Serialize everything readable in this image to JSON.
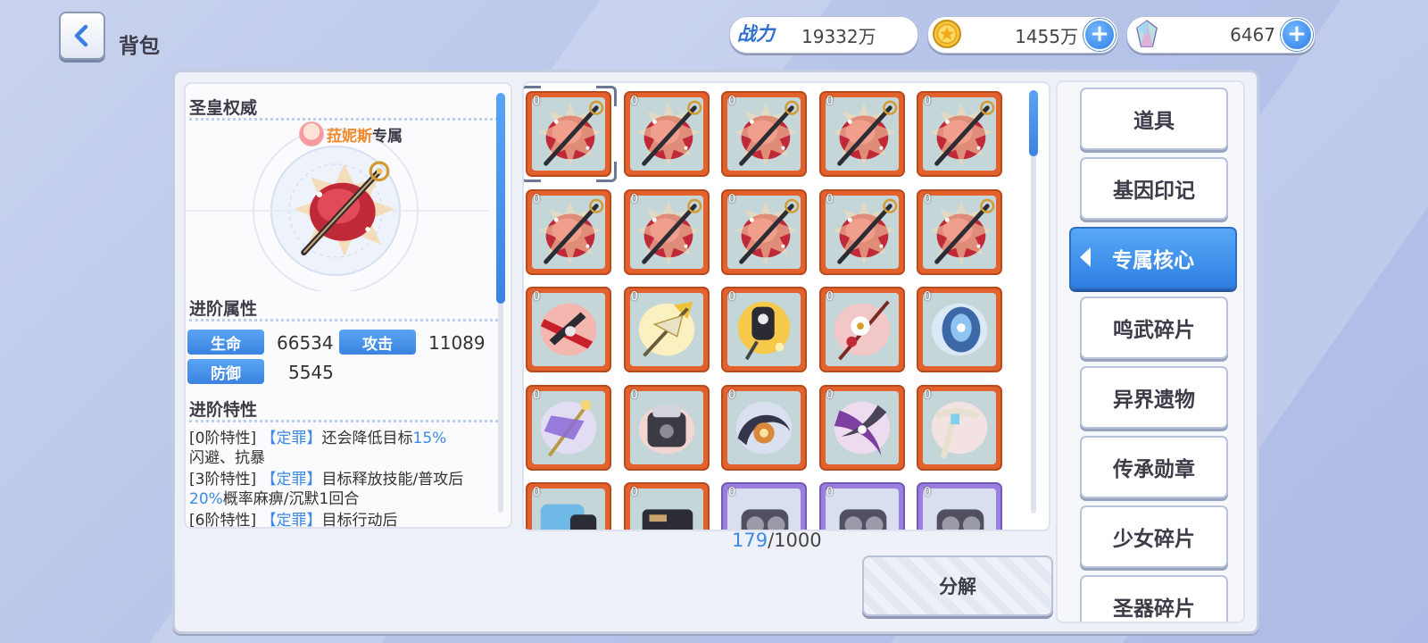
{
  "header": {
    "title": "背包",
    "back_icon": "back-arrow-icon"
  },
  "resources": {
    "power": {
      "label": "战力",
      "value": "19332万"
    },
    "gold": {
      "value": "1455万",
      "icon": "gold-coin-icon"
    },
    "gem": {
      "value": "6467",
      "icon": "crystal-icon"
    }
  },
  "detail": {
    "item_name": "圣皇权威",
    "owner": "菈妮斯",
    "exclusive_suffix": "专属",
    "attr_title": "进阶属性",
    "stats": [
      {
        "label": "生命",
        "value": "66534"
      },
      {
        "label": "攻击",
        "value": "11089"
      },
      {
        "label": "防御",
        "value": "5545"
      }
    ],
    "traits_title": "进阶特性",
    "traits": [
      {
        "prefix": "[0阶特性]",
        "tag": "【定罪】",
        "text1": "还会降低目标",
        "hl": "15%",
        "text2": "闪避、抗暴"
      },
      {
        "prefix": "[3阶特性]",
        "tag": "【定罪】",
        "text1": "目标释放技能/普攻后",
        "hl": "20%",
        "text2": "概率麻痹/沉默1回合"
      },
      {
        "prefix": "[6阶特性]",
        "tag": "【定罪】",
        "text1": "目标行动后",
        "hl": "",
        "text2": ""
      }
    ]
  },
  "inventory": {
    "count_current": "179",
    "count_sep": "/",
    "count_max": "1000",
    "items": [
      {
        "type": "scepter",
        "frame": "orange",
        "count": "0",
        "selected": true
      },
      {
        "type": "scepter",
        "frame": "orange",
        "count": "0"
      },
      {
        "type": "scepter",
        "frame": "orange",
        "count": "0"
      },
      {
        "type": "scepter",
        "frame": "orange",
        "count": "0"
      },
      {
        "type": "scepter",
        "frame": "orange",
        "count": "0"
      },
      {
        "type": "scepter",
        "frame": "orange",
        "count": "0"
      },
      {
        "type": "scepter",
        "frame": "orange",
        "count": "0"
      },
      {
        "type": "scepter",
        "frame": "orange",
        "count": "0"
      },
      {
        "type": "scepter",
        "frame": "orange",
        "count": "0"
      },
      {
        "type": "scepter",
        "frame": "orange",
        "count": "0"
      },
      {
        "type": "red-blade",
        "frame": "orange",
        "count": "0"
      },
      {
        "type": "gold-spear",
        "frame": "orange",
        "count": "0"
      },
      {
        "type": "chain-gear",
        "frame": "orange",
        "count": "0"
      },
      {
        "type": "rose-staff",
        "frame": "orange",
        "count": "0"
      },
      {
        "type": "blue-mech",
        "frame": "orange",
        "count": "0"
      },
      {
        "type": "purple-staff",
        "frame": "orange",
        "count": "0"
      },
      {
        "type": "engine-core",
        "frame": "orange",
        "count": "0"
      },
      {
        "type": "tentacle-orb",
        "frame": "orange",
        "count": "0"
      },
      {
        "type": "crescent-blade",
        "frame": "orange",
        "count": "0"
      },
      {
        "type": "bone-claw",
        "frame": "orange",
        "count": "0"
      },
      {
        "type": "blue-canister",
        "frame": "orange",
        "count": "0"
      },
      {
        "type": "dark-frame",
        "frame": "orange",
        "count": "0"
      },
      {
        "type": "gear-part",
        "frame": "purple",
        "count": "0"
      },
      {
        "type": "gear-part",
        "frame": "purple",
        "count": "0"
      },
      {
        "type": "gear-part",
        "frame": "purple",
        "count": "0"
      }
    ]
  },
  "actions": {
    "decompose": "分解"
  },
  "categories": [
    {
      "label": "道具",
      "active": false
    },
    {
      "label": "基因印记",
      "active": false
    },
    {
      "label": "专属核心",
      "active": true
    },
    {
      "label": "鸣武碎片",
      "active": false
    },
    {
      "label": "异界遗物",
      "active": false
    },
    {
      "label": "传承勋章",
      "active": false
    },
    {
      "label": "少女碎片",
      "active": false
    },
    {
      "label": "圣器碎片",
      "active": false
    }
  ],
  "colors": {
    "accent_blue": "#3c8ae6",
    "owner_orange": "#f08a2a",
    "frame_orange": "#e2612d",
    "frame_purple": "#9c7de0"
  }
}
